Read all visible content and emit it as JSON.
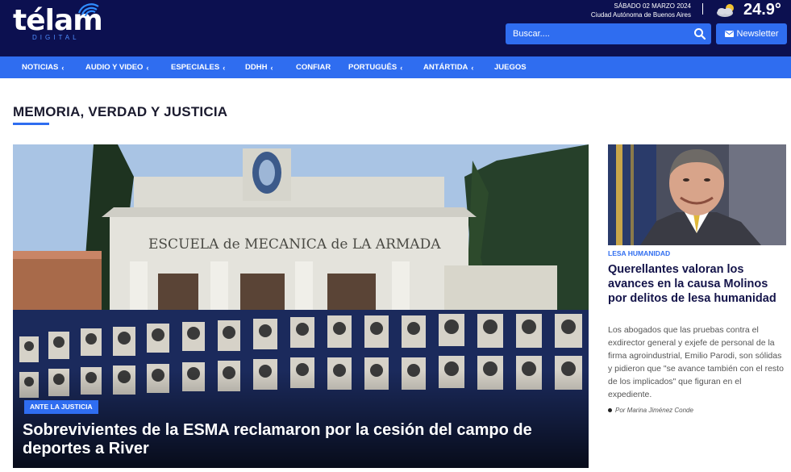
{
  "header": {
    "logo_text": "télam",
    "logo_sub": "DIGITAL",
    "date": "SÁBADO 02 MARZO 2024",
    "city": "Ciudad Autónoma de Buenos Aires",
    "temperature": "24.9°",
    "weather_icon": "partly-cloudy-icon",
    "search_placeholder": "Buscar....",
    "newsletter_label": "Newsletter"
  },
  "nav": {
    "items": [
      {
        "label": "NOTICIAS",
        "dropdown": true
      },
      {
        "label": "AUDIO Y VIDEO",
        "dropdown": true
      },
      {
        "label": "ESPECIALES",
        "dropdown": true
      },
      {
        "label": "DDHH",
        "dropdown": true
      },
      {
        "label": "CONFIAR",
        "dropdown": false
      },
      {
        "label": "PORTUGUÊS",
        "dropdown": true
      },
      {
        "label": "ANTÁRTIDA",
        "dropdown": true
      },
      {
        "label": "JUEGOS",
        "dropdown": false
      }
    ],
    "chevron": "‹"
  },
  "section": {
    "title": "MEMORIA, VERDAD Y JUSTICIA"
  },
  "feature": {
    "building_sign": "ESCUELA de MECANICA de LA ARMADA",
    "tag": "ANTE LA JUSTICIA",
    "headline": "Sobrevivientes de la ESMA reclamaron por la cesión del campo de deportes a River"
  },
  "side": {
    "category": "LESA HUMANIDAD",
    "headline": "Querellantes valoran los avances en la causa Molinos por delitos de lesa humanidad",
    "body": "Los abogados que las pruebas contra el exdirector general y exjefe de personal de la firma agroindustrial, Emilio Parodi, son sólidas y pidieron que \"se avance también con el resto de los implicados\" que figuran en el expediente.",
    "byline": "Por Marina Jiménez Conde"
  },
  "colors": {
    "header_bg": "#0c1050",
    "accent": "#2f6df0",
    "headline_dark": "#14144a"
  }
}
